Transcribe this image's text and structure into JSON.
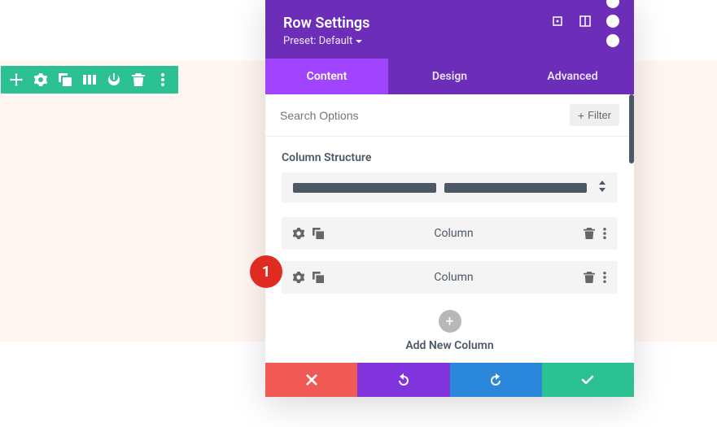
{
  "toolbar": {
    "icons": [
      "move",
      "gear",
      "duplicate",
      "columns",
      "power",
      "trash",
      "more"
    ]
  },
  "modal": {
    "title": "Row Settings",
    "preset": "Preset: Default",
    "tabs": [
      {
        "label": "Content",
        "active": true
      },
      {
        "label": "Design",
        "active": false
      },
      {
        "label": "Advanced",
        "active": false
      }
    ],
    "search_placeholder": "Search Options",
    "filter_label": "Filter",
    "section_title": "Column Structure",
    "columns": [
      {
        "label": "Column"
      },
      {
        "label": "Column"
      }
    ],
    "add_label": "Add New Column"
  },
  "annotation": {
    "num": "1"
  }
}
